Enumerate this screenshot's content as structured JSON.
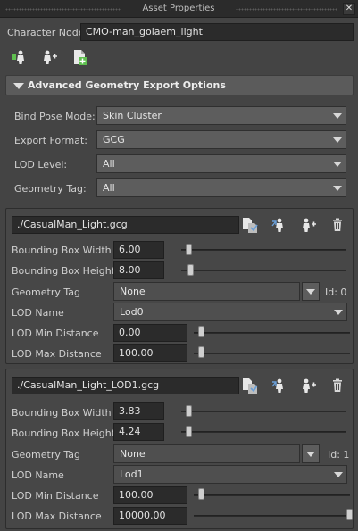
{
  "window": {
    "title": "Asset Properties"
  },
  "character": {
    "label": "Character Node",
    "value": "CMO-man_golaem_light"
  },
  "section": {
    "title": "Advanced Geometry Export Options"
  },
  "options": [
    {
      "label": "Bind Pose Mode:",
      "value": "Skin Cluster"
    },
    {
      "label": "Export Format:",
      "value": "GCG"
    },
    {
      "label": "LOD Level:",
      "value": "All"
    },
    {
      "label": "Geometry Tag:",
      "value": "All"
    }
  ],
  "lods": [
    {
      "file": "./CasualMan_Light.gcg",
      "bbox_width_label": "Bounding Box Width",
      "bbox_width": "6.00",
      "bbox_height_label": "Bounding Box Height",
      "bbox_height": "8.00",
      "geometry_tag_label": "Geometry Tag",
      "geometry_tag": "None",
      "id_text": "Id: 0",
      "lod_name_label": "LOD Name",
      "lod_name": "Lod0",
      "min_dist_label": "LOD Min Distance",
      "min_dist": "0.00",
      "max_dist_label": "LOD Max Distance",
      "max_dist": "100.00",
      "sliders": {
        "width": 0.0,
        "height": 0.01,
        "min": 0.0,
        "max": 0.0
      }
    },
    {
      "file": "./CasualMan_Light_LOD1.gcg",
      "bbox_width_label": "Bounding Box Width",
      "bbox_width": "3.83",
      "bbox_height_label": "Bounding Box Height",
      "bbox_height": "4.24",
      "geometry_tag_label": "Geometry Tag",
      "geometry_tag": "None",
      "id_text": "Id: 1",
      "lod_name_label": "LOD Name",
      "lod_name": "Lod1",
      "min_dist_label": "LOD Min Distance",
      "min_dist": "100.00",
      "max_dist_label": "LOD Max Distance",
      "max_dist": "10000.00",
      "sliders": {
        "width": 0.0,
        "height": 0.0,
        "min": 0.0,
        "max": 1.0
      }
    }
  ],
  "icons": [
    "character-icon",
    "add-character-icon",
    "add-geometry-icon",
    "browse-file-icon",
    "export-character-icon",
    "add-character-icon",
    "trash-icon"
  ],
  "colors": {
    "background": "#444444",
    "panel": "#474747",
    "field": "#2b2b2b",
    "combo": "#5d5d5d",
    "section_header": "#5b5b5b",
    "icon_green": "#5fbf4f",
    "icon_blue": "#6a9fd8"
  }
}
